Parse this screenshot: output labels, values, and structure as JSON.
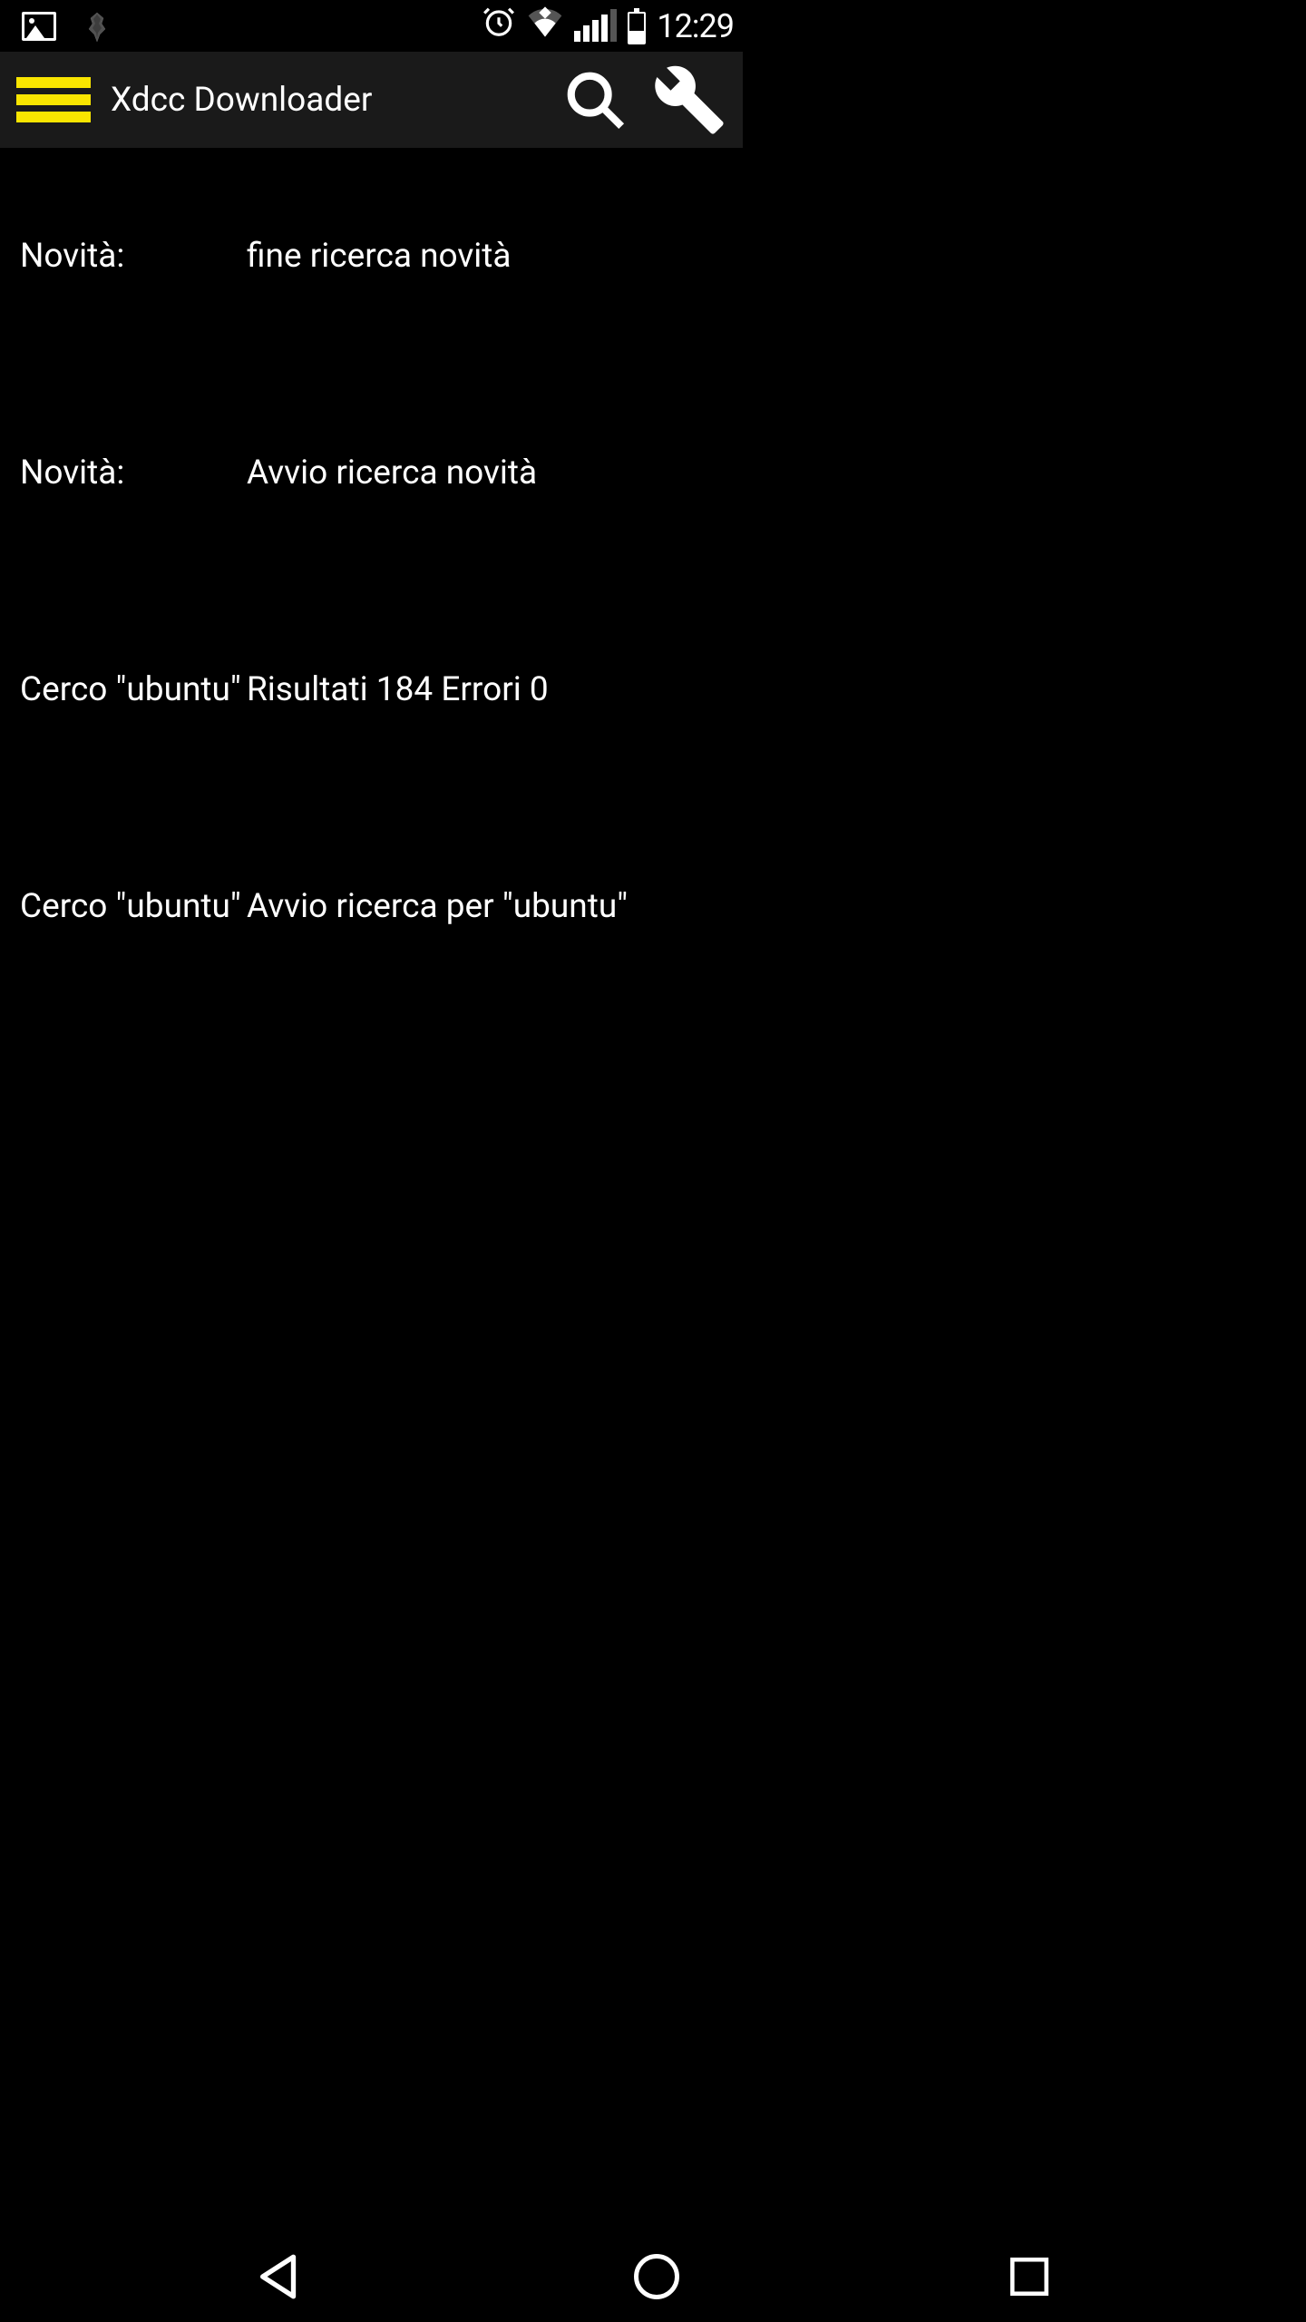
{
  "status_bar": {
    "clock": "12:29"
  },
  "app_bar": {
    "title": "Xdcc Downloader"
  },
  "log": {
    "rows": [
      {
        "label": "Novità:",
        "value": "fine ricerca novità"
      },
      {
        "label": "Novità:",
        "value": "Avvio ricerca novità"
      },
      {
        "label": "Cerco \"ubuntu\"",
        "value": "Risultati 184   Errori 0"
      },
      {
        "label": "Cerco \"ubuntu\"",
        "value": "Avvio ricerca per \"ubuntu\""
      }
    ]
  },
  "colors": {
    "accent": "#F9E500",
    "appbar_bg": "#1a1a1a",
    "bg": "#000000",
    "text": "#ffffff"
  }
}
